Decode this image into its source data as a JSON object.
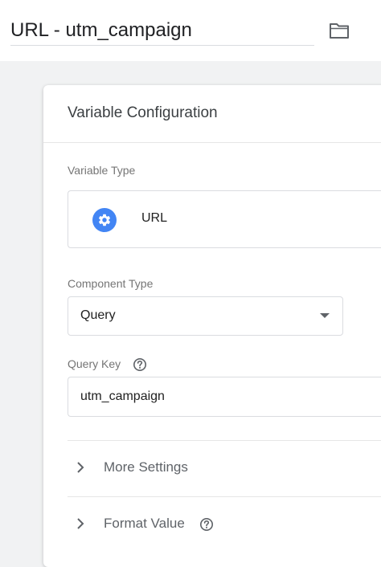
{
  "header": {
    "variable_name": "URL - utm_campaign",
    "folder_icon": "folder-icon"
  },
  "card": {
    "title": "Variable Configuration",
    "variable_type": {
      "label": "Variable Type",
      "name": "URL",
      "icon": "gear-icon"
    },
    "component_type": {
      "label": "Component Type",
      "value": "Query"
    },
    "query_key": {
      "label": "Query Key",
      "value": "utm_campaign"
    },
    "sections": [
      {
        "label": "More Settings"
      },
      {
        "label": "Format Value"
      }
    ]
  },
  "colors": {
    "accent": "#4285f4",
    "icon_gray": "#5f6368",
    "label_gray": "#757575",
    "border": "#dadce0",
    "background": "#f1f2f3"
  }
}
